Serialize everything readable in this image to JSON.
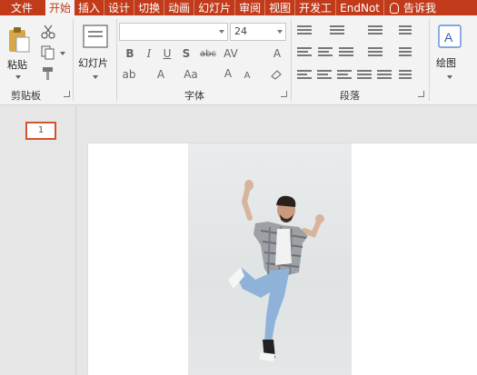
{
  "tabs": [
    {
      "label": "文件"
    },
    {
      "label": "开始"
    },
    {
      "label": "插入"
    },
    {
      "label": "设计"
    },
    {
      "label": "切换"
    },
    {
      "label": "动画"
    },
    {
      "label": "幻灯片"
    },
    {
      "label": "审阅"
    },
    {
      "label": "视图"
    },
    {
      "label": "开发工"
    },
    {
      "label": "EndNot"
    },
    {
      "label": "告诉我"
    }
  ],
  "ribbon": {
    "clipboard": {
      "paste_label": "粘贴",
      "group_label": "剪贴板"
    },
    "slides": {
      "new_slide_label": "幻灯片"
    },
    "font": {
      "font_name_value": "",
      "font_size_value": "24",
      "group_label": "字体"
    },
    "paragraph": {
      "group_label": "段落"
    },
    "drawing": {
      "label": "绘图"
    }
  },
  "thumbnails": [
    {
      "number": "1"
    }
  ],
  "colors": {
    "accent": "#c13b1b",
    "ribbon_bg": "#f3f3f3",
    "selection_border": "#d35230"
  }
}
